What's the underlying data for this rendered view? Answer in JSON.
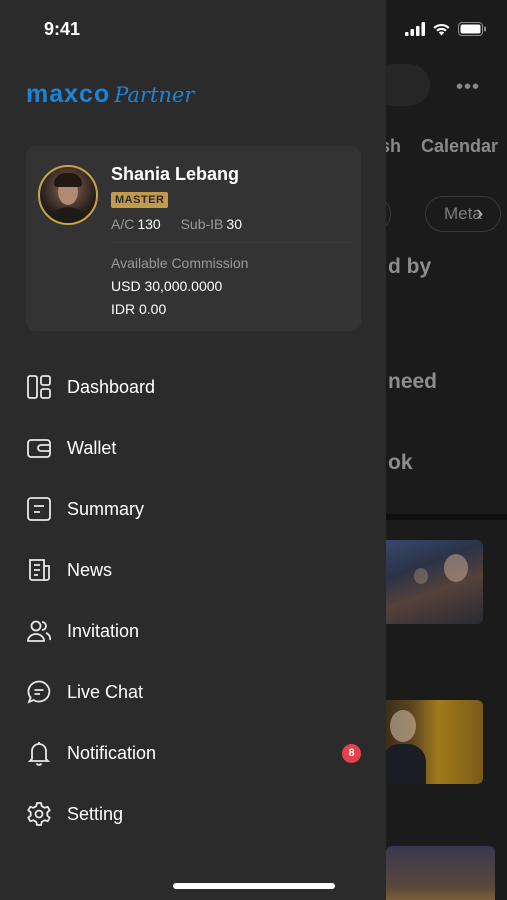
{
  "status_bar": {
    "time": "9:41"
  },
  "brand": {
    "logo_main": "maxco",
    "logo_sub": "Partner",
    "accent": "#1b84d8"
  },
  "profile": {
    "name": "Shania Lebang",
    "tier": "MASTER",
    "ac_label": "A/C",
    "ac_value": "130",
    "subib_label": "Sub-IB",
    "subib_value": "30",
    "commission_label": "Available Commission",
    "commission_usd": "USD 30,000.0000",
    "commission_idr": "IDR 0.00"
  },
  "menu": {
    "items": [
      {
        "label": "Dashboard",
        "icon": "dashboard-icon"
      },
      {
        "label": "Wallet",
        "icon": "wallet-icon"
      },
      {
        "label": "Summary",
        "icon": "summary-icon"
      },
      {
        "label": "News",
        "icon": "news-icon"
      },
      {
        "label": "Invitation",
        "icon": "invitation-icon"
      },
      {
        "label": "Live Chat",
        "icon": "chat-icon"
      },
      {
        "label": "Notification",
        "icon": "bell-icon",
        "badge": "8"
      },
      {
        "label": "Setting",
        "icon": "gear-icon"
      }
    ],
    "badge_color": "#e8414b"
  },
  "background": {
    "tabs": [
      "sh",
      "Calendar"
    ],
    "chips": [
      "s",
      "Meta"
    ],
    "snippets": [
      "d by",
      "need",
      "ok"
    ]
  }
}
